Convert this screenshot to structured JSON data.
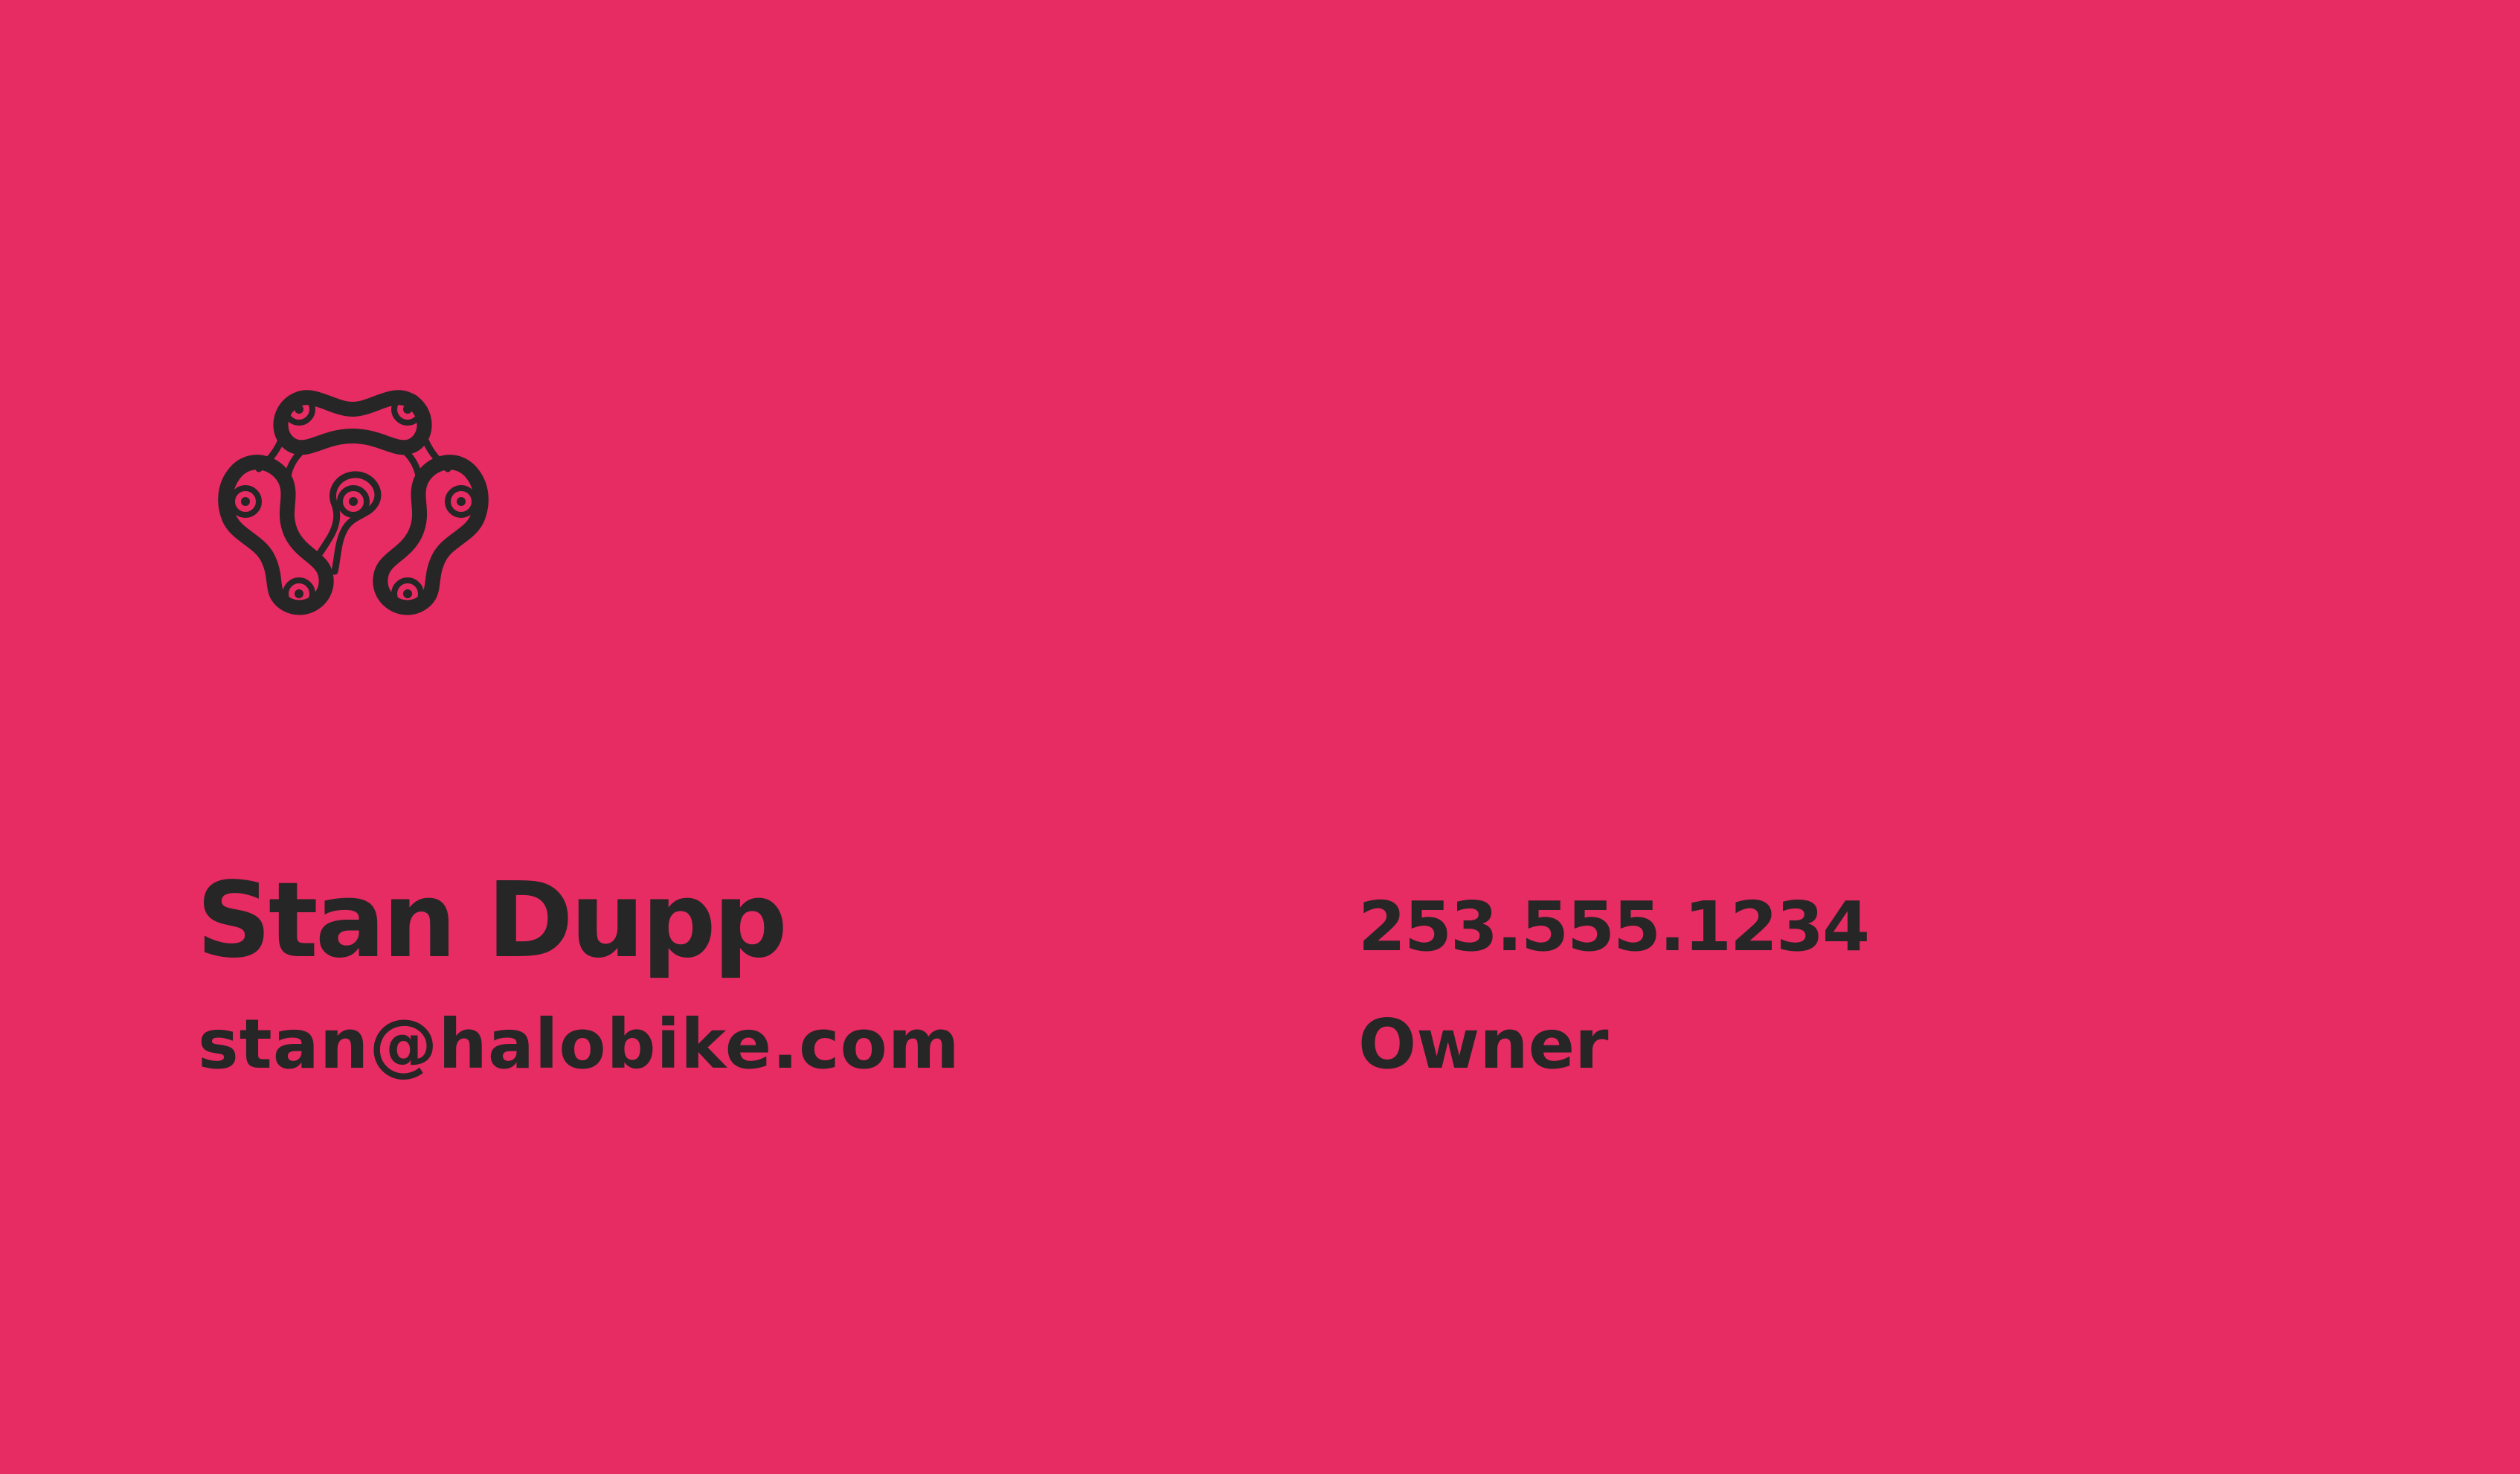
{
  "colors": {
    "background": "#E72B63",
    "ink": "#262626"
  },
  "logo": {
    "icon": "bike-chain-logo-icon"
  },
  "contact": {
    "name": "Stan Dupp",
    "email": "stan@halobike.com",
    "phone": "253.555.1234",
    "role": "Owner"
  }
}
